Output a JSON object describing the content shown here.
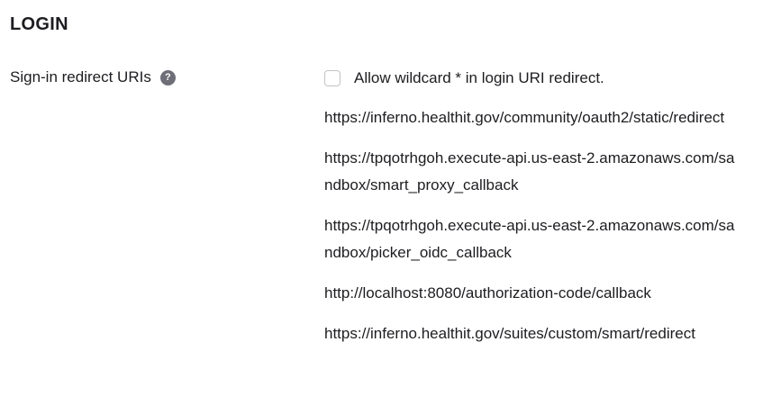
{
  "section": {
    "title": "LOGIN"
  },
  "field": {
    "label": "Sign-in redirect URIs",
    "help_icon": "question-mark-icon"
  },
  "wildcard": {
    "label": "Allow wildcard * in login URI redirect.",
    "checked": false
  },
  "uris": [
    "https://inferno.healthit.gov/community/oauth2/static/redirect",
    "https://tpqotrhgoh.execute-api.us-east-2.amazonaws.com/sandbox/smart_proxy_callback",
    "https://tpqotrhgoh.execute-api.us-east-2.amazonaws.com/sandbox/picker_oidc_callback",
    "http://localhost:8080/authorization-code/callback",
    "https://inferno.healthit.gov/suites/custom/smart/redirect"
  ],
  "help_icon_glyph": "?"
}
